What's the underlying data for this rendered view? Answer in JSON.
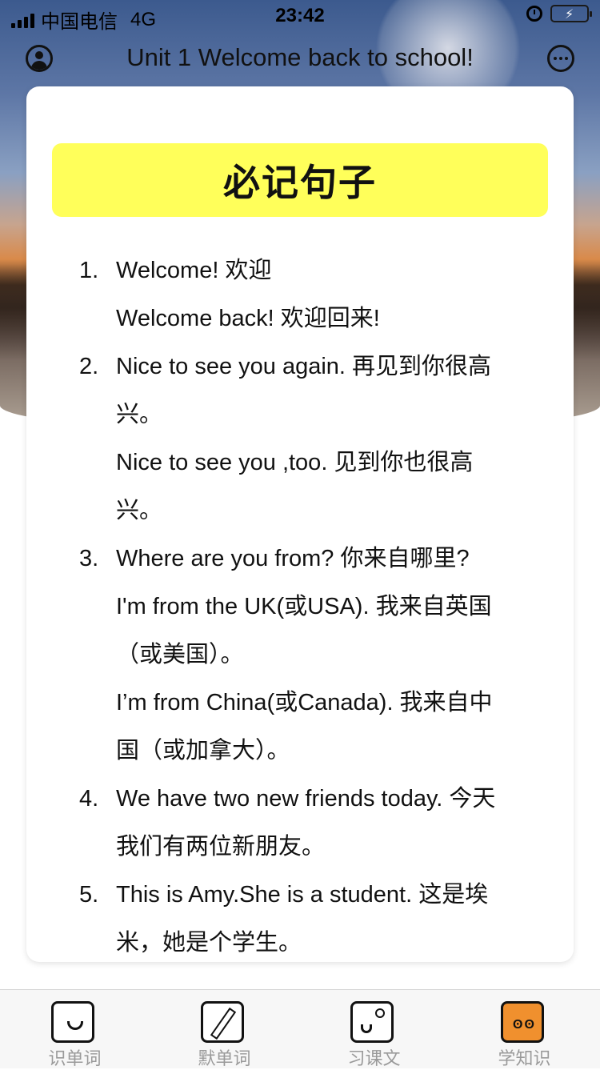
{
  "status_bar": {
    "carrier": "中国电信",
    "network": "4G",
    "time": "23:42"
  },
  "nav": {
    "title": "Unit 1 Welcome back to school!"
  },
  "card": {
    "heading": "必记句子",
    "items": [
      {
        "number": "1.",
        "lines": [
          "Welcome! 欢迎",
          "Welcome back! 欢迎回来!"
        ]
      },
      {
        "number": "2.",
        "lines": [
          "Nice to see you again. 再见到你很高",
          "兴。",
          "Nice to see you ,too. 见到你也很高",
          "兴。"
        ]
      },
      {
        "number": "3.",
        "lines": [
          "Where are you from? 你来自哪里?",
          "I'm from the UK(或USA). 我来自英国",
          "（或美国）。",
          "I’m from China(或Canada). 我来自中",
          "国（或加拿大）。"
        ]
      },
      {
        "number": "4.",
        "lines": [
          "We have two new friends today. 今天",
          "我们有两位新朋友。"
        ]
      },
      {
        "number": "5.",
        "lines": [
          "This is Amy.She is a student. 这是埃",
          "米，她是个学生。"
        ]
      }
    ]
  },
  "tabbar": {
    "tabs": [
      {
        "label": "识单词",
        "icon": "face-card-icon",
        "active": false
      },
      {
        "label": "默单词",
        "icon": "pen-writing-icon",
        "active": false
      },
      {
        "label": "习课文",
        "icon": "book-icon",
        "active": false
      },
      {
        "label": "学知识",
        "icon": "knowledge-face-icon",
        "active": true
      }
    ],
    "active_color": "#f0902e"
  },
  "colors": {
    "banner": "#ffff5a",
    "battery": "#39c44a"
  }
}
